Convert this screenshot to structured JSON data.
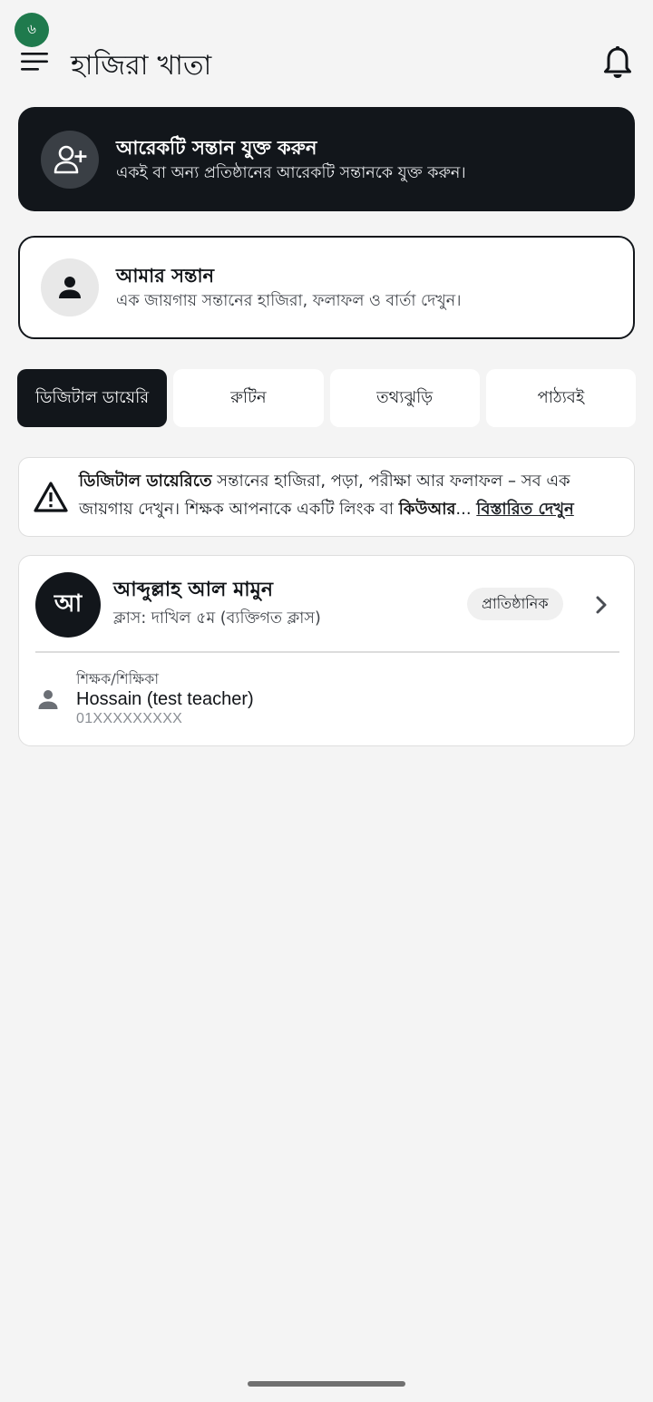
{
  "status_bar": {
    "indicator": "৬"
  },
  "header": {
    "title": "হাজিরা খাতা",
    "menu_icon": "hamburger-menu-icon",
    "notification_icon": "bell-icon"
  },
  "add_child_card": {
    "title": "আরেকটি সন্তান যুক্ত করুন",
    "subtitle": "একই বা অন্য প্রতিষ্ঠানের আরেকটি সন্তানকে যুক্ত করুন।",
    "icon": "add-person-icon"
  },
  "my_children_card": {
    "title": "আমার সন্তান",
    "subtitle": "এক জায়গায় সন্তানের হাজিরা, ফলাফল ও বার্তা দেখুন।",
    "icon": "person-icon"
  },
  "tabs": [
    {
      "label": "ডিজিটাল ডায়েরি",
      "active": true
    },
    {
      "label": "রুটিন",
      "active": false
    },
    {
      "label": "তথ্যঝুড়ি",
      "active": false
    },
    {
      "label": "পাঠ্যবই",
      "active": false
    }
  ],
  "notice": {
    "bold_lead": "ডিজিটাল ডায়েরিতে",
    "text_1": " সন্তানের হাজিরা, পড়া, পরীক্ষা আর ফলাফল – সব এক জায়গায় দেখুন। শিক্ষক আপনাকে একটি লিংক বা ",
    "bold_mid": "কিউআর",
    "ellipsis": "... ",
    "link": "বিস্তারিত দেখুন",
    "icon": "warning-icon"
  },
  "student": {
    "avatar_initial": "আ",
    "name": "আব্দুল্লাহ আল মামুন",
    "class_info": "ক্লাস: দাখিল ৫ম  (ব্যক্তিগত ক্লাস)",
    "badge": "প্রাতিষ্ঠানিক",
    "teacher_label": "শিক্ষক/শিক্ষিকা",
    "teacher_name": "Hossain (test teacher)",
    "teacher_phone": "01XXXXXXXXX"
  },
  "colors": {
    "dark": "#12161b",
    "background": "#f4f4f4",
    "status_dot": "#1f7a4d"
  }
}
